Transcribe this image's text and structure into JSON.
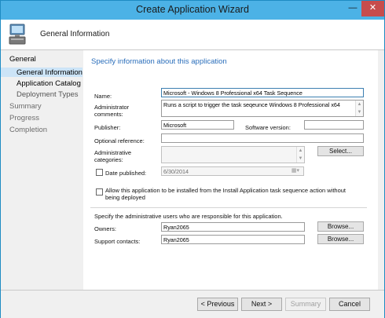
{
  "window": {
    "title": "Create Application Wizard",
    "minimize_glyph": "—",
    "close_glyph": "✕"
  },
  "header": {
    "title": "General Information",
    "icon": "computer-icon"
  },
  "nav": {
    "items": [
      {
        "label": "General"
      },
      {
        "label": "General Information"
      },
      {
        "label": "Application Catalog"
      },
      {
        "label": "Deployment Types"
      },
      {
        "label": "Summary"
      },
      {
        "label": "Progress"
      },
      {
        "label": "Completion"
      }
    ]
  },
  "content": {
    "heading": "Specify information about this application",
    "name": {
      "label": "Name:",
      "value": "Microsoft - Windows 8 Professional x64 Task Sequence"
    },
    "admin_comments": {
      "label1": "Administrator",
      "label2": "comments:",
      "value": "Runs a script to trigger the task seqeunce Windows 8 Professional x64"
    },
    "publisher": {
      "label": "Publisher:",
      "value": "Microsoft"
    },
    "software_version": {
      "label": "Software version:",
      "value": ""
    },
    "optional_reference": {
      "label": "Optional reference:",
      "value": ""
    },
    "admin_categories": {
      "label1": "Administrative",
      "label2": "categories:",
      "value": "",
      "select_button": "Select..."
    },
    "date_published": {
      "label": "Date published:",
      "value": "6/30/2014"
    },
    "allow_install": {
      "label1": "Allow this application to be installed from the Install Application task sequence action without",
      "label2": "being deployed"
    },
    "admin_users_text": "Specify the administrative users who are responsible for this application.",
    "owners": {
      "label": "Owners:",
      "value": "Ryan2065",
      "browse": "Browse..."
    },
    "support_contacts": {
      "label": "Support contacts:",
      "value": "Ryan2065",
      "browse": "Browse..."
    }
  },
  "footer": {
    "previous": "< Previous",
    "next": "Next >",
    "summary": "Summary",
    "cancel": "Cancel"
  },
  "colors": {
    "titlebar": "#4cb2e6",
    "close": "#c74c4c",
    "heading": "#2a6ebb",
    "selection": "#cce4f7"
  }
}
